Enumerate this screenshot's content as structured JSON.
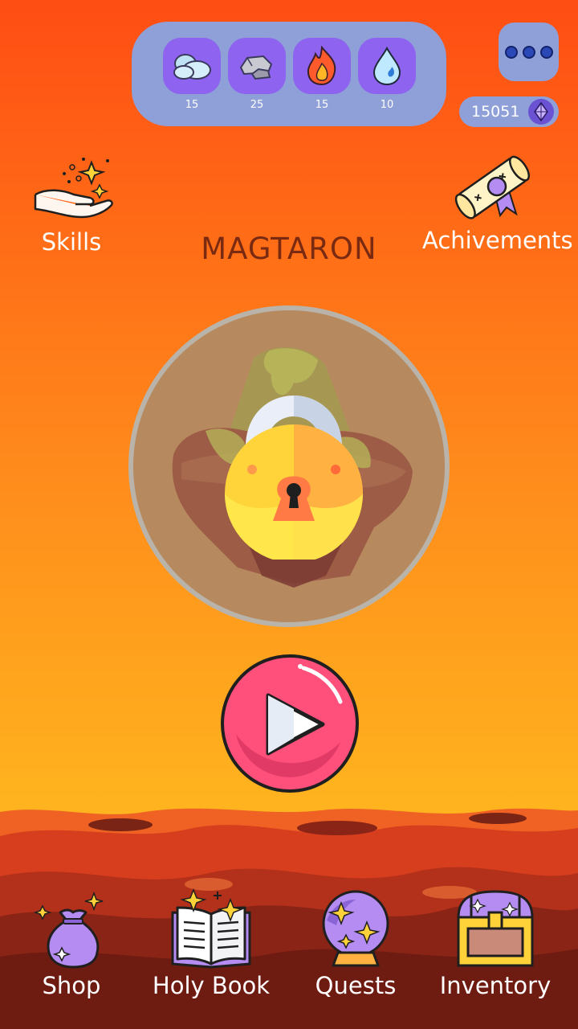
{
  "resources": [
    {
      "icon": "cloud-icon",
      "count": "15"
    },
    {
      "icon": "rock-icon",
      "count": "25"
    },
    {
      "icon": "fire-icon",
      "count": "15"
    },
    {
      "icon": "water-drop-icon",
      "count": "10"
    }
  ],
  "gems": {
    "count": "15051",
    "icon": "gem-icon"
  },
  "left_action": {
    "label": "Skills",
    "icon": "magic-hand-icon"
  },
  "right_action": {
    "label": "Achivements",
    "icon": "scroll-icon"
  },
  "world": {
    "name": "MAGTARON",
    "locked": true,
    "icon": "padlock-icon"
  },
  "play": {
    "icon": "play-icon"
  },
  "nav": [
    {
      "label": "Shop",
      "icon": "money-bag-icon"
    },
    {
      "label": "Holy Book",
      "icon": "open-book-icon"
    },
    {
      "label": "Quests",
      "icon": "crystal-ball-icon"
    },
    {
      "label": "Inventory",
      "icon": "treasure-chest-icon"
    }
  ],
  "colors": {
    "accent": "#8d63f0",
    "panel": "#8f9fd8",
    "title": "#7a2a10",
    "play": "#ff4f7b"
  }
}
